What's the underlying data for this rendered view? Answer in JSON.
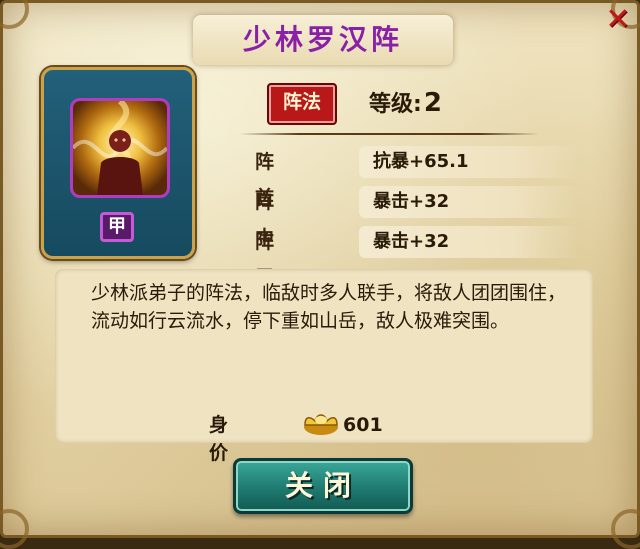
{
  "dialog": {
    "title": "少林罗汉阵",
    "close_icon": "close-x-icon"
  },
  "portrait": {
    "grade": "甲"
  },
  "formation": {
    "badge_label": "阵法",
    "level_label": "等级:",
    "level_value": "2"
  },
  "positions": [
    {
      "label": "阵首",
      "value": "抗暴+65.1"
    },
    {
      "label": "阵中",
      "value": "暴击+32"
    },
    {
      "label": "阵尾",
      "value": "暴击+32"
    }
  ],
  "description": "少林派弟子的阵法，临敌时多人联手，将敌人团团围住，流动如行云流水，停下重如山岳，敌人极难突围。",
  "price": {
    "label": "身价",
    "icon": "gold-ingot-icon",
    "value": "601"
  },
  "buttons": {
    "close_label": "关闭"
  }
}
